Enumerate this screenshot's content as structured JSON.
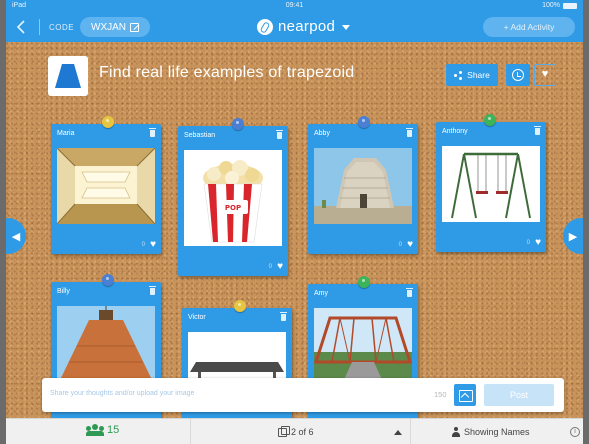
{
  "statusbar": {
    "carrier": "iPad",
    "time": "09:41",
    "battery": "100%"
  },
  "topnav": {
    "code_label": "CODE",
    "code": "WXJAN",
    "brand": "nearpod",
    "add_activity": "+ Add Activity"
  },
  "board": {
    "title": "Find real life examples of trapezoid",
    "share_label": "Share",
    "heart_glyph": "♥",
    "left_arrow": "◀",
    "right_arrow": "▶"
  },
  "posts": [
    {
      "author": "Maria",
      "likes": "0",
      "pin_color": "#e6c640",
      "image": "ceiling-light"
    },
    {
      "author": "Sebastian",
      "likes": "0",
      "pin_color": "#4a7fd4",
      "image": "popcorn"
    },
    {
      "author": "Abby",
      "likes": "0",
      "pin_color": "#4a7fd4",
      "image": "stone-tomb"
    },
    {
      "author": "Anthony",
      "likes": "0",
      "pin_color": "#3db35a",
      "image": "swing-set"
    },
    {
      "author": "Billy",
      "likes": "",
      "pin_color": "#4a7fd4",
      "image": "roof"
    },
    {
      "author": "Victor",
      "likes": "",
      "pin_color": "#e6c640",
      "image": "table"
    },
    {
      "author": "Amy",
      "likes": "",
      "pin_color": "#3db35a",
      "image": "bridge"
    }
  ],
  "composer": {
    "placeholder": "Share your thoughts and/or upload your image",
    "char_count": "150",
    "post_label": "Post"
  },
  "bottombar": {
    "participants": "15",
    "pager": "2 of 6",
    "names_label": "Showing Names",
    "info_glyph": "i"
  },
  "colors": {
    "accent": "#2f9be6",
    "cork": "#c8935a",
    "participants": "#2e9a53"
  }
}
